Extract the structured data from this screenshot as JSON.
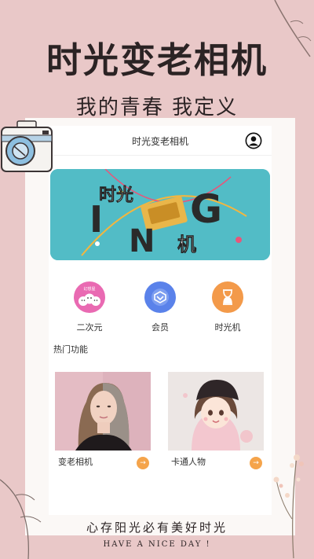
{
  "promo": {
    "title": "时光变老相机",
    "subtitle": "我的青春 我定义",
    "slogan": "心存阳光必有美好时光",
    "tagline": "HAVE A NICE DAY !"
  },
  "navbar": {
    "title": "时光变老相机",
    "avatar_icon": "user-circle-icon"
  },
  "banner": {
    "text_top": "时光",
    "letters": [
      "I",
      "N",
      "G"
    ],
    "text_bottom": "机"
  },
  "quick_actions": [
    {
      "label": "二次元",
      "icon": "anime-faces-icon",
      "color": "#e96ab2",
      "badge": "幻想屋"
    },
    {
      "label": "会员",
      "icon": "vip-diamond-icon",
      "color": "#5a82ea"
    },
    {
      "label": "时光机",
      "icon": "hourglass-icon",
      "color": "#f39a4a"
    }
  ],
  "section": {
    "hot_title": "热门功能"
  },
  "cards": [
    {
      "label": "变老相机",
      "arrow": "→"
    },
    {
      "label": "卡通人物",
      "arrow": "→"
    }
  ],
  "colors": {
    "background": "#e9c8c8",
    "accent_orange": "#f5a44b",
    "banner_teal": "#52bcc6"
  }
}
